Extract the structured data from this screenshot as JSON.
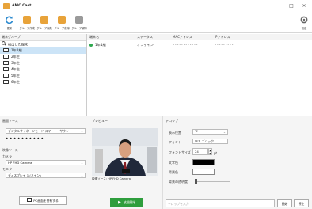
{
  "app": {
    "title": "AMC Cast"
  },
  "window_controls": [
    "–",
    "□",
    "×"
  ],
  "toolbar": [
    {
      "label": "更新",
      "icon": "refresh-icon",
      "color": "#2e8bd0"
    },
    {
      "label": "グループ作成",
      "icon": "group-create-icon",
      "color": "#e8a33a"
    },
    {
      "label": "グループ編集",
      "icon": "group-edit-icon",
      "color": "#e8a33a"
    },
    {
      "label": "グループ削除",
      "icon": "group-delete-icon",
      "color": "#e8a33a"
    },
    {
      "label": "グループ解除",
      "icon": "group-release-icon",
      "color": "#8a8a8a"
    }
  ],
  "toolbar_right": {
    "label": "設定",
    "icon": "settings-icon"
  },
  "groups": {
    "header": "端末グループ",
    "items": [
      {
        "label": "検出した端末",
        "icon": "search-icon"
      },
      {
        "label": "1年1組",
        "icon": "folder-icon",
        "selected": true
      },
      {
        "label": "2年生",
        "icon": "folder-icon"
      },
      {
        "label": "3年生",
        "icon": "folder-icon"
      },
      {
        "label": "4年生",
        "icon": "folder-icon"
      },
      {
        "label": "5年生",
        "icon": "folder-icon"
      },
      {
        "label": "6年生",
        "icon": "folder-icon"
      }
    ]
  },
  "device_table": {
    "columns": [
      "端末名",
      "ステータス",
      "MACアドレス",
      "IPアドレス"
    ],
    "rows": [
      {
        "name": "1年1組",
        "status": "オンライン",
        "mac": "••••••••••••",
        "ip": "•••••••••"
      }
    ],
    "status_color": "#2fa84f"
  },
  "source": {
    "title": "画面ソース",
    "mode_select": "デジタルサイネージモード スマート・サウン",
    "pin_dots": "••••••••••",
    "video_source_label": "映像ソース",
    "camera_label": "カメラ",
    "camera_select": "HP FHD Camera",
    "monitor_label": "モニタ",
    "monitor_select": "ディスプレイ 1 (メイン)",
    "pc_share_button": "PC画面を共有する"
  },
  "preview": {
    "title": "プレビュー",
    "footer": "映像ソース: HP FHD Camera",
    "send_button": "放送開始",
    "send_color": "#2e9e3d"
  },
  "telop": {
    "title": "テロップ",
    "position_label": "表示位置",
    "position_value": "下",
    "font_label": "フォント",
    "font_value": "ＭＳ ゴシック",
    "size_label": "フォントサイズ",
    "size_value": "24",
    "size_unit": "pt",
    "text_color_label": "文字色",
    "text_color": "#000000",
    "bg_color_label": "背景色",
    "bg_color": "#ffffff",
    "opacity_label": "背景の透明度",
    "input_placeholder": "テロップを入力",
    "start_button": "開始",
    "stop_button": "停止"
  }
}
